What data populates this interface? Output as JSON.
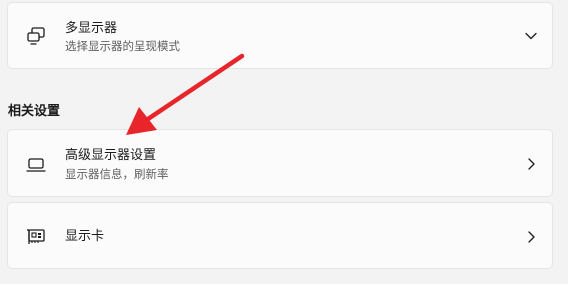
{
  "multi_display": {
    "title": "多显示器",
    "subtitle": "选择显示器的呈现模式",
    "icon": "multi-monitor-icon",
    "expander_icon": "chevron-down-icon"
  },
  "related_settings": {
    "heading": "相关设置",
    "items": [
      {
        "title": "高级显示器设置",
        "subtitle": "显示器信息，刷新率",
        "icon": "laptop-monitor-icon",
        "nav_icon": "chevron-right-icon"
      },
      {
        "title": "显示卡",
        "icon": "graphics-card-icon",
        "nav_icon": "chevron-right-icon"
      }
    ]
  },
  "annotation": {
    "arrow_color": "#e8252a",
    "arrow_icon": "red-arrow-annotation"
  }
}
